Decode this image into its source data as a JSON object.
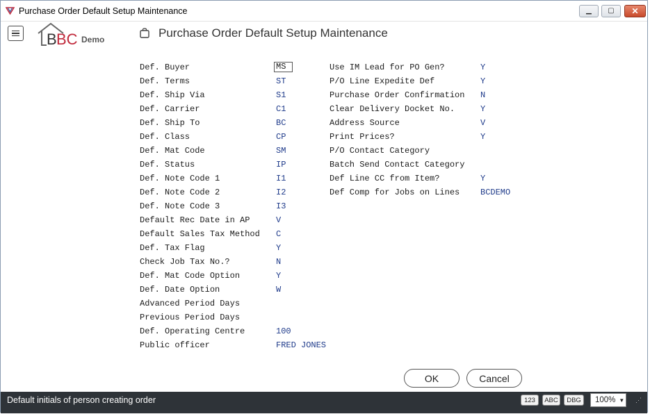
{
  "window": {
    "title": "Purchase Order Default Setup Maintenance"
  },
  "header": {
    "logo_text": "BC",
    "logo_sub": "Demo",
    "page_title": "Purchase Order Default Setup Maintenance"
  },
  "left_fields": [
    {
      "label": "Def. Buyer",
      "value": "MS"
    },
    {
      "label": "Def. Terms",
      "value": "ST"
    },
    {
      "label": "Def. Ship Via",
      "value": "S1"
    },
    {
      "label": "Def. Carrier",
      "value": "C1"
    },
    {
      "label": "Def. Ship To",
      "value": "BC"
    },
    {
      "label": "Def. Class",
      "value": "CP"
    },
    {
      "label": "Def. Mat Code",
      "value": "SM"
    },
    {
      "label": "Def. Status",
      "value": "IP"
    },
    {
      "label": "Def. Note Code 1",
      "value": "I1"
    },
    {
      "label": "Def. Note Code 2",
      "value": "I2"
    },
    {
      "label": "Def. Note Code 3",
      "value": "I3"
    },
    {
      "label": "Default Rec Date in AP",
      "value": "V"
    },
    {
      "label": "Default Sales Tax Method",
      "value": "C"
    },
    {
      "label": "Def. Tax Flag",
      "value": "Y"
    },
    {
      "label": "Check Job Tax No.?",
      "value": "N"
    },
    {
      "label": "Def. Mat Code Option",
      "value": "Y"
    },
    {
      "label": "Def. Date Option",
      "value": "W"
    },
    {
      "label": "Advanced Period Days",
      "value": ""
    },
    {
      "label": "Previous Period Days",
      "value": ""
    },
    {
      "label": "Def. Operating Centre",
      "value": "100"
    },
    {
      "label": "Public officer",
      "value": "FRED JONES"
    }
  ],
  "right_fields": [
    {
      "label": "Use IM Lead for PO Gen?",
      "value": "Y"
    },
    {
      "label": "P/O Line Expedite Def",
      "value": "Y"
    },
    {
      "label": "Purchase Order Confirmation",
      "value": "N"
    },
    {
      "label": "Clear Delivery Docket No.",
      "value": "Y"
    },
    {
      "label": "Address Source",
      "value": "V"
    },
    {
      "label": "Print Prices?",
      "value": "Y"
    },
    {
      "label": "P/O Contact Category",
      "value": ""
    },
    {
      "label": "Batch Send Contact Category",
      "value": ""
    },
    {
      "label": "Def Line CC from Item?",
      "value": "Y"
    },
    {
      "label": "Def Comp for Jobs on Lines",
      "value": "BCDEMO"
    }
  ],
  "buttons": {
    "ok": "OK",
    "cancel": "Cancel"
  },
  "status": {
    "message": "Default initials of person creating order",
    "mode_123": "123",
    "mode_abc": "ABC",
    "mode_dbg": "DBG",
    "zoom": "100%"
  },
  "colors": {
    "value_text": "#1e3a8a",
    "status_bg": "#2e3338",
    "close_button": "#c84a2b"
  }
}
